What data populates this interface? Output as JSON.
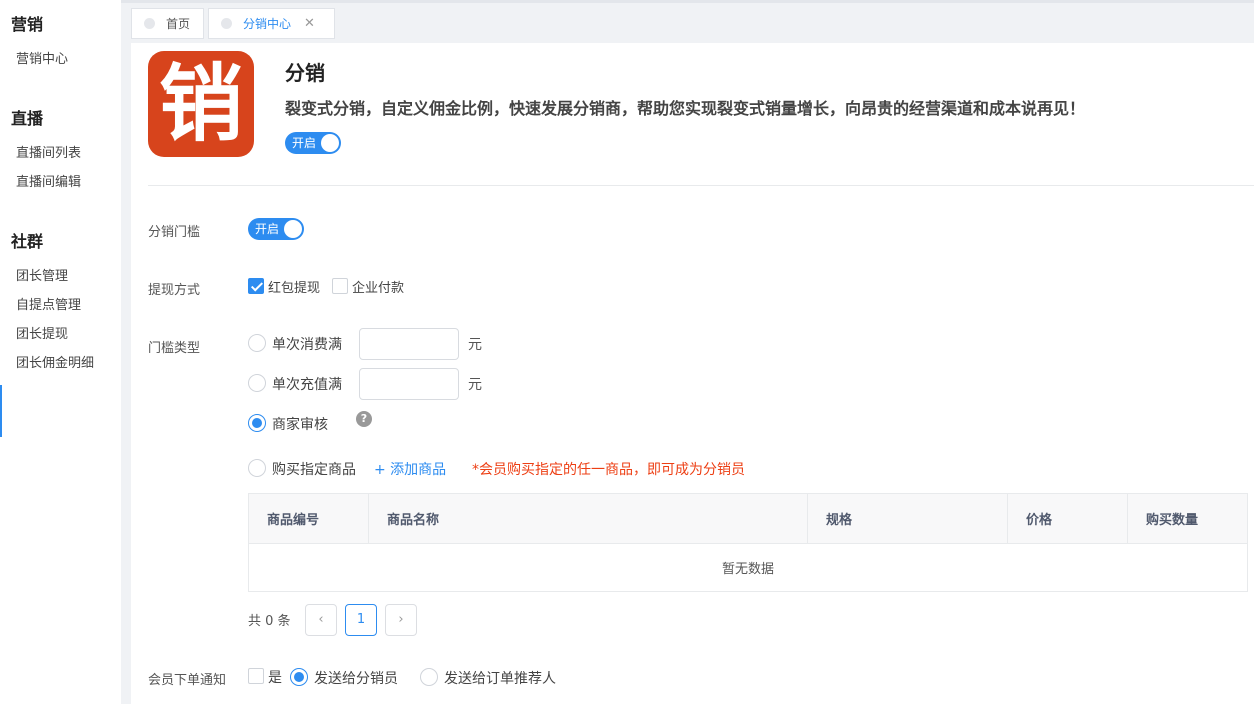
{
  "sidebar": {
    "groups": [
      {
        "title": "营销",
        "items": [
          "营销中心"
        ]
      },
      {
        "title": "直播",
        "items": [
          "直播间列表",
          "直播间编辑"
        ]
      },
      {
        "title": "社群",
        "items": [
          "团长管理",
          "自提点管理",
          "团长提现",
          "团长佣金明细"
        ]
      }
    ]
  },
  "tabs": [
    {
      "label": "首页"
    },
    {
      "label": "分销中心",
      "close": "✕"
    }
  ],
  "app": {
    "logo_char": "销",
    "title": "分销",
    "description": "裂变式分销，自定义佣金比例，快速发展分销商，帮助您实现裂变式销量增长，向昂贵的经营渠道和成本说再见！",
    "switch_label": "开启"
  },
  "form": {
    "threshold": {
      "label": "分销门槛",
      "switch_label": "开启"
    },
    "withdraw": {
      "label": "提现方式",
      "options": [
        {
          "label": "红包提现",
          "checked": true
        },
        {
          "label": "企业付款",
          "checked": false
        }
      ]
    },
    "threshold_type": {
      "label": "门槛类型",
      "single_spend": "单次消费满",
      "single_recharge": "单次充值满",
      "unit": "元",
      "merchant_review": "商家审核",
      "help": "?",
      "buy_product": "购买指定商品",
      "add_product": "+ 添加商品",
      "buy_note": "*会员购买指定的任一商品，即可成为分销员"
    },
    "table": {
      "columns": [
        "商品编号",
        "商品名称",
        "规格",
        "价格",
        "购买数量"
      ],
      "empty": "暂无数据"
    },
    "pager": {
      "total": "共 0 条",
      "prev": "‹",
      "page": "1",
      "next": "›"
    },
    "notify": {
      "label": "会员下单通知",
      "yes": "是",
      "to_distributor": "发送给分销员",
      "to_referrer": "发送给订单推荐人"
    }
  }
}
